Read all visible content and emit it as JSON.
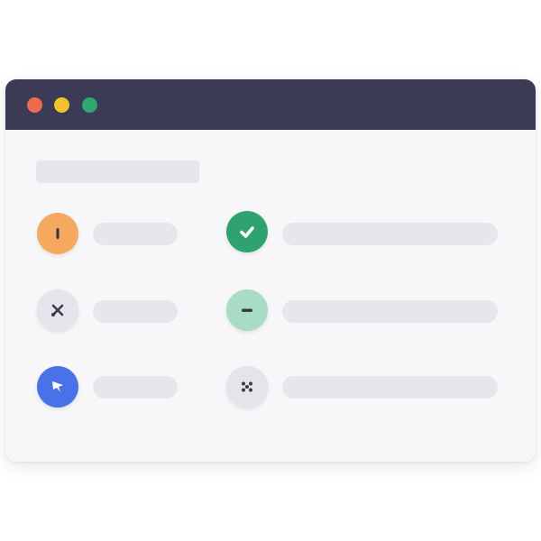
{
  "window": {
    "titlebar_color": "#3b3b55",
    "traffic_lights": [
      {
        "name": "close",
        "color": "#ee6b4d"
      },
      {
        "name": "minimize",
        "color": "#f2c12e"
      },
      {
        "name": "maximize",
        "color": "#2fa86e"
      }
    ]
  },
  "list": {
    "left_items": [
      {
        "icon": "exclamation-icon",
        "color": "#f4a95f"
      },
      {
        "icon": "crossed-tools-icon",
        "color": "#e4e4ea"
      },
      {
        "icon": "pin-icon",
        "color": "#4a72e8"
      }
    ],
    "right_items": [
      {
        "icon": "checkmark-icon",
        "color": "#2fa36f"
      },
      {
        "icon": "minus-icon",
        "color": "#a9dcc4"
      },
      {
        "icon": "dots-icon",
        "color": "#e4e4ea"
      }
    ]
  }
}
